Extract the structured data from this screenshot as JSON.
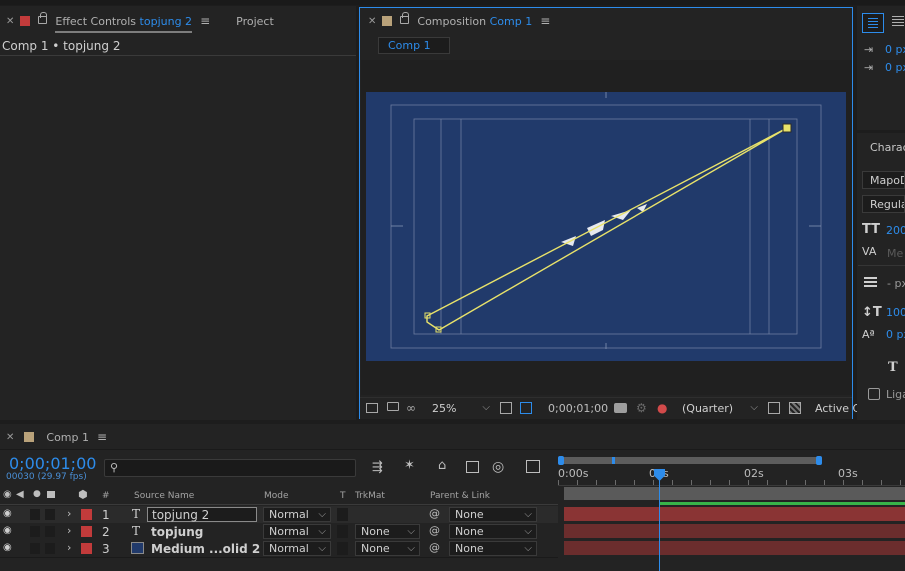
{
  "effect_controls": {
    "tab_label": "Effect Controls",
    "tab_layer": "topjung 2",
    "project_tab": "Project",
    "breadcrumb": "Comp 1 • topjung 2"
  },
  "composition": {
    "tab_label": "Composition",
    "tab_comp": "Comp 1",
    "subtab": "Comp 1",
    "zoom": "25%",
    "timecode": "0;00;01;00",
    "resolution": "(Quarter)",
    "view": "Active C"
  },
  "character_panel": {
    "title": "Charac",
    "font_family": "MapoD",
    "font_style": "Regula",
    "font_size": "200",
    "kerning": "Me",
    "leading_unit": "- px",
    "vertical_scale": "100",
    "baseline_shift": "0 px",
    "indent_top": "0 px",
    "indent_bottom": "0 px",
    "ligatures": "Liga"
  },
  "timeline": {
    "tab_label": "Comp 1",
    "timecode": "0;00;01;00",
    "fps": "00030 (29.97 fps)",
    "search_placeholder": "",
    "columns": {
      "hash": "#",
      "source_name": "Source Name",
      "mode": "Mode",
      "t": "T",
      "trkmat": "TrkMat",
      "parent": "Parent & Link"
    },
    "ruler": [
      "0:00s",
      "01s",
      "02s",
      "03s"
    ],
    "layers": [
      {
        "num": "1",
        "type": "T",
        "name": "topjung 2",
        "mode": "Normal",
        "trkmat": "",
        "parent": "None"
      },
      {
        "num": "2",
        "type": "T",
        "name": "topjung",
        "mode": "Normal",
        "trkmat": "None",
        "parent": "None"
      },
      {
        "num": "3",
        "type": "solid",
        "name": "Medium ...olid 2",
        "mode": "Normal",
        "trkmat": "None",
        "parent": "None"
      }
    ]
  },
  "colors": {
    "accent": "#2d8ceb",
    "label_red": "#c23b3b",
    "comp_bg": "#213a6b",
    "path_yellow": "#e8e26a"
  }
}
